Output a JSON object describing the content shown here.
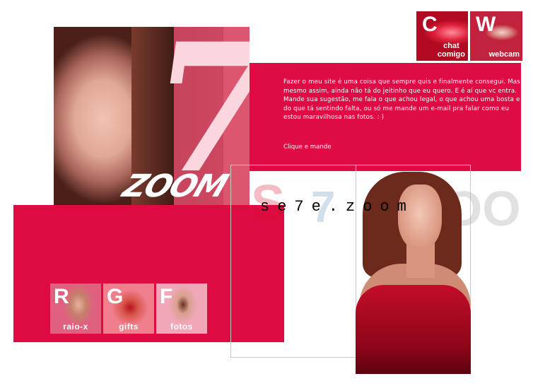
{
  "header": {
    "seven_numeral": "7",
    "zoom_logo": "ZOOM",
    "site_name": "se7e.zoom"
  },
  "badges": [
    {
      "letter": "C",
      "label_line1": "chat",
      "label_line2": "comigo"
    },
    {
      "letter": "W",
      "label_line1": "webcam",
      "label_line2": ""
    }
  ],
  "message": {
    "text": "Fazer o meu site é uma coisa que sempre quis e finalmente consegui. Mas mesmo assim, ainda não tá do jeitinho que eu quero. E é aí que vc entra. Mande sua sugestão, me fala o que achou legal, o que achou uma bosta e do que tá sentindo falta, ou só me mande um e-mail pra falar como eu estou maravilhosa nas fotos. : )",
    "link_label": "Clique e mande"
  },
  "nav": [
    {
      "letter": "R",
      "label": "raio-x"
    },
    {
      "letter": "G",
      "label": "gifts"
    },
    {
      "letter": "F",
      "label": "fotos"
    }
  ],
  "watermark": {
    "s": "S",
    "seven": "7",
    "zoo": "ZOO"
  },
  "colors": {
    "brand_red": "#df0b44",
    "pink": "#fbd6de"
  }
}
